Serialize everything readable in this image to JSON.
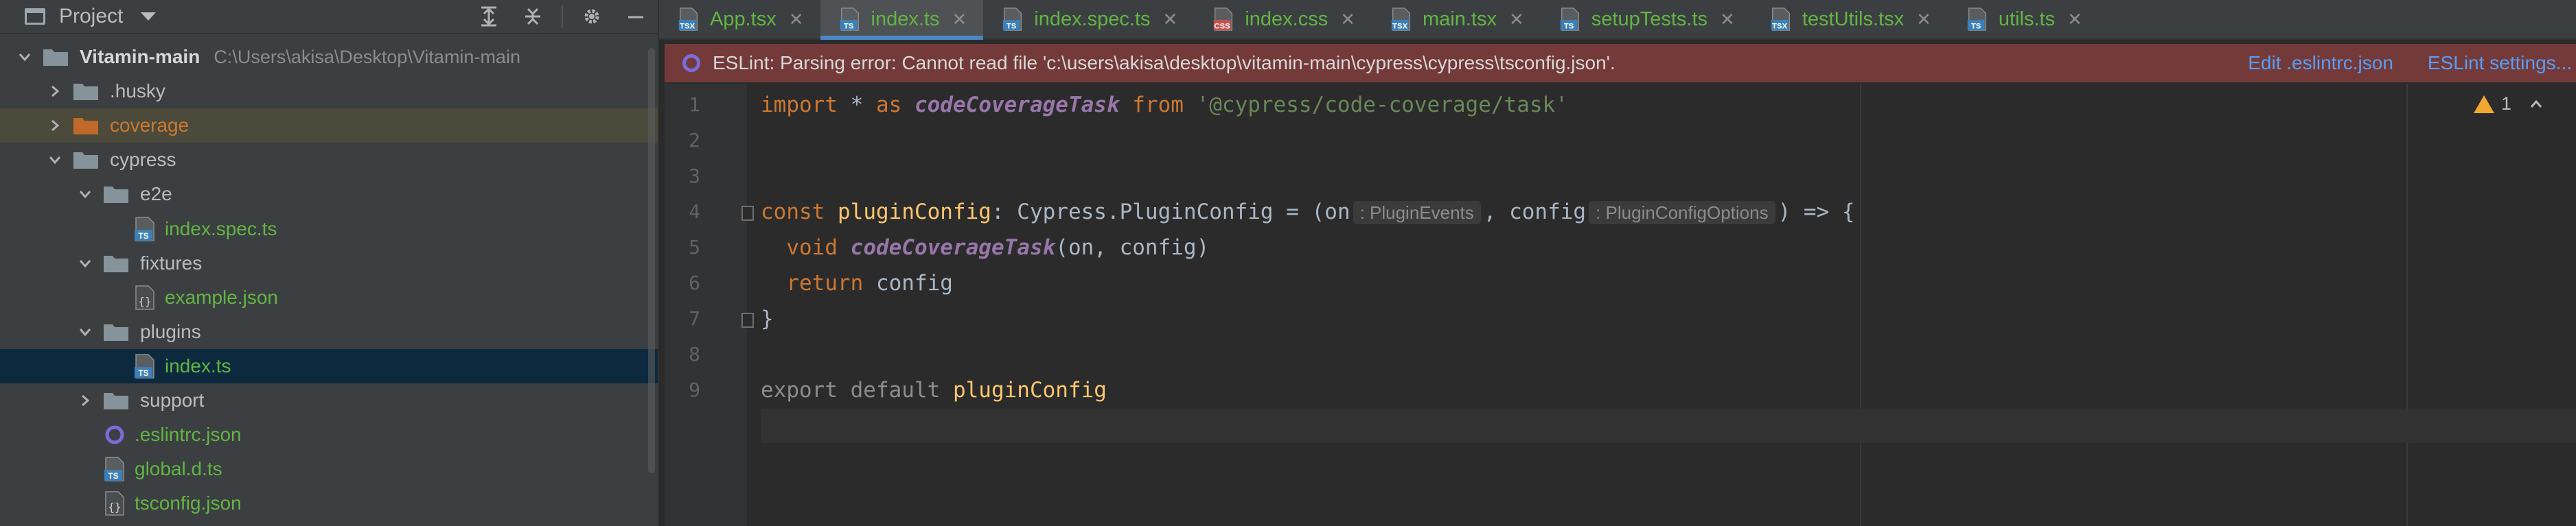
{
  "project_panel": {
    "title": "Project",
    "tree": [
      {
        "label": "Vitamin-main",
        "path": "C:\\Users\\akisa\\Desktop\\Vitamin-main",
        "depth": 0,
        "kind": "folder",
        "expanded": true
      },
      {
        "label": ".husky",
        "depth": 1,
        "kind": "folder",
        "expanded": false
      },
      {
        "label": "coverage",
        "depth": 1,
        "kind": "folder-orange",
        "expanded": false
      },
      {
        "label": "cypress",
        "depth": 1,
        "kind": "folder",
        "expanded": true
      },
      {
        "label": "e2e",
        "depth": 2,
        "kind": "folder",
        "expanded": true
      },
      {
        "label": "index.spec.ts",
        "depth": 3,
        "kind": "ts"
      },
      {
        "label": "fixtures",
        "depth": 2,
        "kind": "folder",
        "expanded": true
      },
      {
        "label": "example.json",
        "depth": 3,
        "kind": "json"
      },
      {
        "label": "plugins",
        "depth": 2,
        "kind": "folder",
        "expanded": true
      },
      {
        "label": "index.ts",
        "depth": 3,
        "kind": "ts",
        "selected": true
      },
      {
        "label": "support",
        "depth": 2,
        "kind": "folder",
        "expanded": false
      },
      {
        "label": ".eslintrc.json",
        "depth": 2,
        "kind": "eslint"
      },
      {
        "label": "global.d.ts",
        "depth": 2,
        "kind": "ts"
      },
      {
        "label": "tsconfig.json",
        "depth": 2,
        "kind": "json"
      }
    ]
  },
  "tabs": [
    {
      "label": "App.tsx",
      "icon": "tsx",
      "active": false
    },
    {
      "label": "index.ts",
      "icon": "ts",
      "active": true
    },
    {
      "label": "index.spec.ts",
      "icon": "ts",
      "active": false
    },
    {
      "label": "index.css",
      "icon": "css",
      "active": false
    },
    {
      "label": "main.tsx",
      "icon": "tsx",
      "active": false
    },
    {
      "label": "setupTests.ts",
      "icon": "ts",
      "active": false
    },
    {
      "label": "testUtils.tsx",
      "icon": "tsx",
      "active": false
    },
    {
      "label": "utils.ts",
      "icon": "ts",
      "active": false
    }
  ],
  "banner": {
    "message": "ESLint: Parsing error: Cannot read file 'c:\\users\\akisa\\desktop\\vitamin-main\\cypress\\cypress\\tsconfig.json'.",
    "edit_link": "Edit .eslintrc.json",
    "settings_link": "ESLint settings..."
  },
  "editor": {
    "line_numbers": [
      "1",
      "2",
      "3",
      "4",
      "5",
      "6",
      "7",
      "8",
      "9"
    ],
    "warning_count": "1",
    "tokens": {
      "l1_import": "import",
      "l1_star": " * ",
      "l1_as": "as",
      "l1_name": "codeCoverageTask",
      "l1_from": "from",
      "l1_str": "'@cypress/code-coverage/task'",
      "l3_const": "const",
      "l3_var": "pluginConfig",
      "l3_type": ": Cypress.PluginConfig = (on",
      "l3_hint1": ": PluginEvents",
      "l3_comma": ", config",
      "l3_hint2": ": PluginConfigOptions",
      "l3_end": ") => {",
      "l4_void": "void",
      "l4_call": "codeCoverageTask",
      "l4_args": "(on, config)",
      "l5_return": "return",
      "l5_val": " config",
      "l6_brace": "}",
      "l8_export": "export default",
      "l8_name": "pluginConfig"
    }
  },
  "colors": {
    "accent": "#4a88c7",
    "ts_badge": "#3c7fb9",
    "tsx_badge": "#3c7fb9",
    "css_badge": "#c94f4f",
    "banner_bg": "#743a3a",
    "link": "#589df6",
    "warning": "#f0a732"
  }
}
